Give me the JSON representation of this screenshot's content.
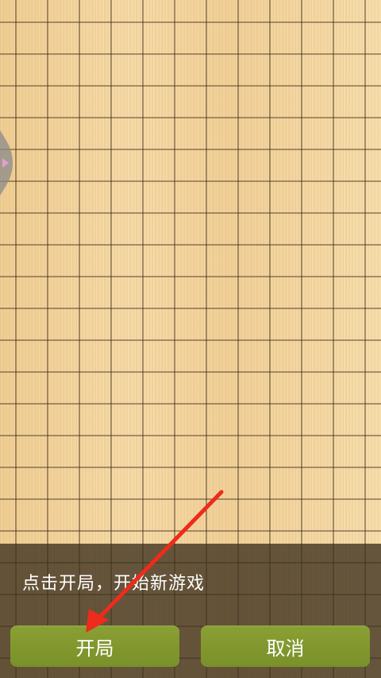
{
  "board": {
    "line_color": "#3a2a18"
  },
  "dialog": {
    "tip": "点击开局，开始新游戏",
    "start_label": "开局",
    "cancel_label": "取消",
    "button_color": "#819a2e"
  },
  "annotation": {
    "arrow_color": "#ee2b1c"
  }
}
